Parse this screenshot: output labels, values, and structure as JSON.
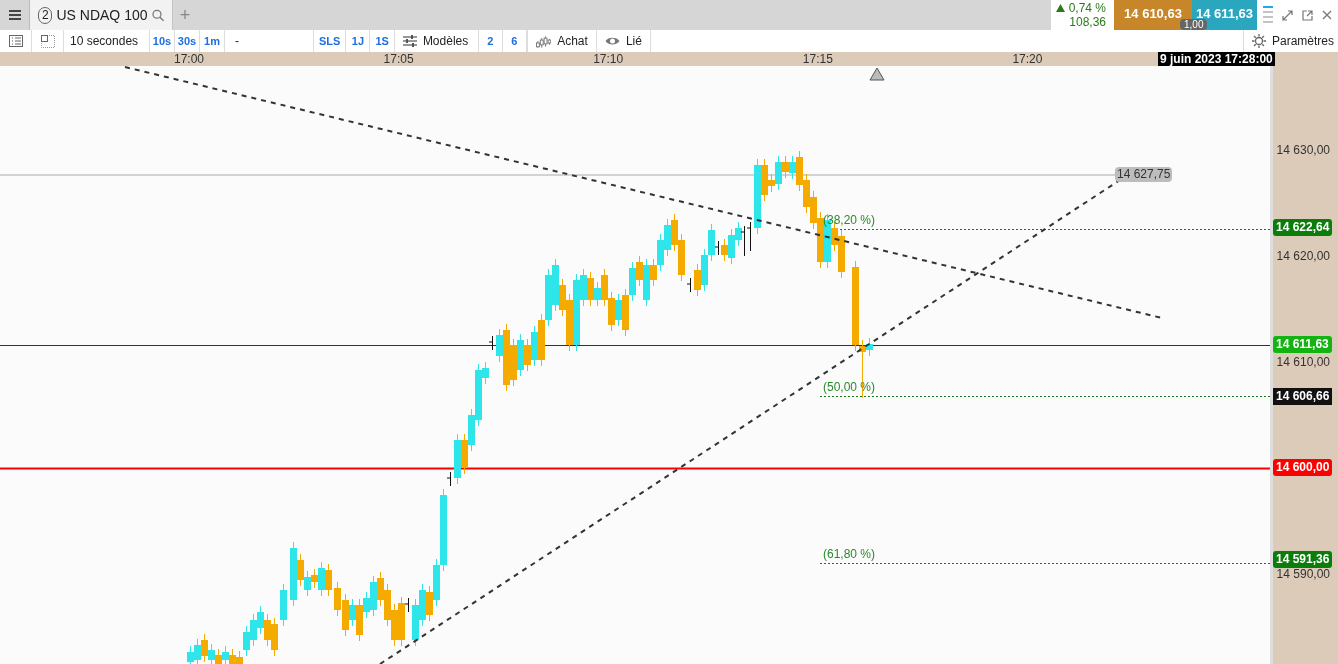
{
  "header": {
    "tab": {
      "badge": "2",
      "title": "US NDAQ 100"
    },
    "new_tab": "+",
    "change": {
      "rising": true,
      "percent": "0,74 %",
      "points": "108,36"
    },
    "bid": "14 610,63",
    "ask": "14 611,63",
    "spread": "1,00"
  },
  "toolbar": {
    "interval": "10 secondes",
    "quick_intervals": [
      "10s",
      "30s",
      "1m"
    ],
    "separator": "-",
    "periods": [
      "SLS",
      "1J",
      "1S"
    ],
    "templates": "Modèles",
    "counts": [
      "2",
      "6"
    ],
    "order": "Achat",
    "link": "Lié",
    "settings": "Paramètres"
  },
  "chart": {
    "time_labels": [
      "17:00",
      "17:05",
      "17:10",
      "17:15",
      "17:20"
    ],
    "cursor_time": "9 juin 2023 17:28:00",
    "price_ticks": [
      "14 630,00",
      "14 620,00",
      "14 610,00",
      "14 590,00"
    ],
    "price_markers": [
      {
        "kind": "level",
        "label": "14 622,64",
        "color": "#0b7d0b"
      },
      {
        "kind": "last",
        "label": "14 611,63",
        "color": "#12b312"
      },
      {
        "kind": "cursor",
        "label": "14 606,66",
        "color": "#111111"
      },
      {
        "kind": "alert",
        "label": "14 600,00",
        "color": "#ff0000"
      },
      {
        "kind": "level",
        "label": "14 591,36",
        "color": "#0b7d0b"
      }
    ],
    "fib_levels": [
      "(38,20 %)",
      "(50,00 %)",
      "(61,80 %)"
    ],
    "trendline_label": "14 627,75"
  }
}
